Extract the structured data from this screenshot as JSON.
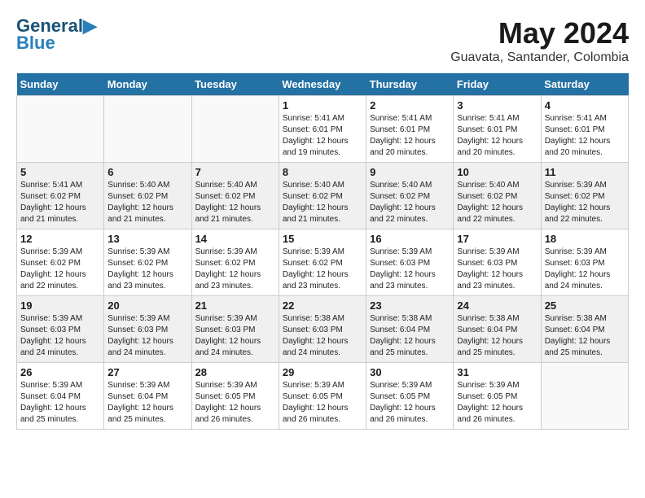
{
  "header": {
    "logo_line1": "General",
    "logo_line2": "Blue",
    "month": "May 2024",
    "location": "Guavata, Santander, Colombia"
  },
  "days_of_week": [
    "Sunday",
    "Monday",
    "Tuesday",
    "Wednesday",
    "Thursday",
    "Friday",
    "Saturday"
  ],
  "weeks": [
    [
      {
        "day": "",
        "info": ""
      },
      {
        "day": "",
        "info": ""
      },
      {
        "day": "",
        "info": ""
      },
      {
        "day": "1",
        "info": "Sunrise: 5:41 AM\nSunset: 6:01 PM\nDaylight: 12 hours\nand 19 minutes."
      },
      {
        "day": "2",
        "info": "Sunrise: 5:41 AM\nSunset: 6:01 PM\nDaylight: 12 hours\nand 20 minutes."
      },
      {
        "day": "3",
        "info": "Sunrise: 5:41 AM\nSunset: 6:01 PM\nDaylight: 12 hours\nand 20 minutes."
      },
      {
        "day": "4",
        "info": "Sunrise: 5:41 AM\nSunset: 6:01 PM\nDaylight: 12 hours\nand 20 minutes."
      }
    ],
    [
      {
        "day": "5",
        "info": "Sunrise: 5:41 AM\nSunset: 6:02 PM\nDaylight: 12 hours\nand 21 minutes."
      },
      {
        "day": "6",
        "info": "Sunrise: 5:40 AM\nSunset: 6:02 PM\nDaylight: 12 hours\nand 21 minutes."
      },
      {
        "day": "7",
        "info": "Sunrise: 5:40 AM\nSunset: 6:02 PM\nDaylight: 12 hours\nand 21 minutes."
      },
      {
        "day": "8",
        "info": "Sunrise: 5:40 AM\nSunset: 6:02 PM\nDaylight: 12 hours\nand 21 minutes."
      },
      {
        "day": "9",
        "info": "Sunrise: 5:40 AM\nSunset: 6:02 PM\nDaylight: 12 hours\nand 22 minutes."
      },
      {
        "day": "10",
        "info": "Sunrise: 5:40 AM\nSunset: 6:02 PM\nDaylight: 12 hours\nand 22 minutes."
      },
      {
        "day": "11",
        "info": "Sunrise: 5:39 AM\nSunset: 6:02 PM\nDaylight: 12 hours\nand 22 minutes."
      }
    ],
    [
      {
        "day": "12",
        "info": "Sunrise: 5:39 AM\nSunset: 6:02 PM\nDaylight: 12 hours\nand 22 minutes."
      },
      {
        "day": "13",
        "info": "Sunrise: 5:39 AM\nSunset: 6:02 PM\nDaylight: 12 hours\nand 23 minutes."
      },
      {
        "day": "14",
        "info": "Sunrise: 5:39 AM\nSunset: 6:02 PM\nDaylight: 12 hours\nand 23 minutes."
      },
      {
        "day": "15",
        "info": "Sunrise: 5:39 AM\nSunset: 6:02 PM\nDaylight: 12 hours\nand 23 minutes."
      },
      {
        "day": "16",
        "info": "Sunrise: 5:39 AM\nSunset: 6:03 PM\nDaylight: 12 hours\nand 23 minutes."
      },
      {
        "day": "17",
        "info": "Sunrise: 5:39 AM\nSunset: 6:03 PM\nDaylight: 12 hours\nand 23 minutes."
      },
      {
        "day": "18",
        "info": "Sunrise: 5:39 AM\nSunset: 6:03 PM\nDaylight: 12 hours\nand 24 minutes."
      }
    ],
    [
      {
        "day": "19",
        "info": "Sunrise: 5:39 AM\nSunset: 6:03 PM\nDaylight: 12 hours\nand 24 minutes."
      },
      {
        "day": "20",
        "info": "Sunrise: 5:39 AM\nSunset: 6:03 PM\nDaylight: 12 hours\nand 24 minutes."
      },
      {
        "day": "21",
        "info": "Sunrise: 5:39 AM\nSunset: 6:03 PM\nDaylight: 12 hours\nand 24 minutes."
      },
      {
        "day": "22",
        "info": "Sunrise: 5:38 AM\nSunset: 6:03 PM\nDaylight: 12 hours\nand 24 minutes."
      },
      {
        "day": "23",
        "info": "Sunrise: 5:38 AM\nSunset: 6:04 PM\nDaylight: 12 hours\nand 25 minutes."
      },
      {
        "day": "24",
        "info": "Sunrise: 5:38 AM\nSunset: 6:04 PM\nDaylight: 12 hours\nand 25 minutes."
      },
      {
        "day": "25",
        "info": "Sunrise: 5:38 AM\nSunset: 6:04 PM\nDaylight: 12 hours\nand 25 minutes."
      }
    ],
    [
      {
        "day": "26",
        "info": "Sunrise: 5:39 AM\nSunset: 6:04 PM\nDaylight: 12 hours\nand 25 minutes."
      },
      {
        "day": "27",
        "info": "Sunrise: 5:39 AM\nSunset: 6:04 PM\nDaylight: 12 hours\nand 25 minutes."
      },
      {
        "day": "28",
        "info": "Sunrise: 5:39 AM\nSunset: 6:05 PM\nDaylight: 12 hours\nand 26 minutes."
      },
      {
        "day": "29",
        "info": "Sunrise: 5:39 AM\nSunset: 6:05 PM\nDaylight: 12 hours\nand 26 minutes."
      },
      {
        "day": "30",
        "info": "Sunrise: 5:39 AM\nSunset: 6:05 PM\nDaylight: 12 hours\nand 26 minutes."
      },
      {
        "day": "31",
        "info": "Sunrise: 5:39 AM\nSunset: 6:05 PM\nDaylight: 12 hours\nand 26 minutes."
      },
      {
        "day": "",
        "info": ""
      }
    ]
  ]
}
